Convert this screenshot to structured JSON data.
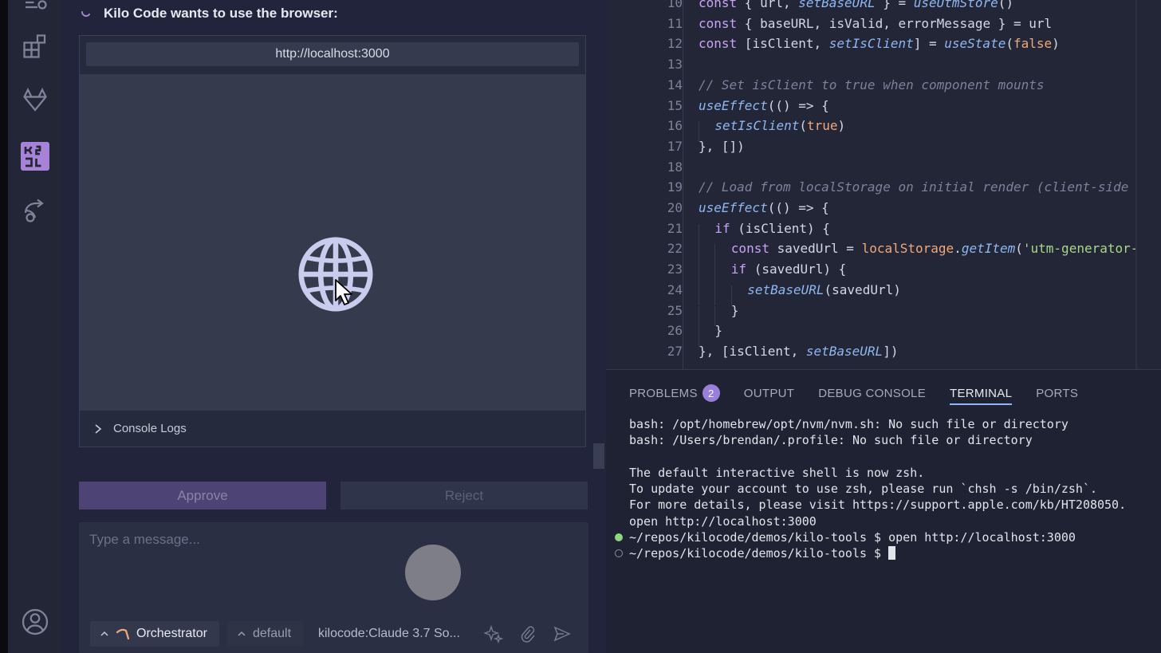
{
  "colors": {
    "accent": "#a783d8",
    "keyword": "#c9a3f5",
    "func": "#8fb7f2",
    "string": "#a9d88b",
    "comment": "#7d8199",
    "number": "#f0a97a",
    "terminal_ok": "#8fd67e"
  },
  "chat": {
    "title": "Kilo Code wants to use the browser:",
    "browser": {
      "url": "http://localhost:3000",
      "placeholder_icon": "globe-icon",
      "console_label": "Console Logs"
    },
    "approve_label": "Approve",
    "reject_label": "Reject",
    "message_placeholder": "Type a message...",
    "mode": "Orchestrator",
    "profile": "default",
    "model": "kilocode:Claude 3.7 So..."
  },
  "activity": {
    "icons": [
      "explorer-icon",
      "extensions-icon",
      "gitlab-icon",
      "kilo-code-icon",
      "remote-icon",
      "account-icon"
    ]
  },
  "editor": {
    "lines": [
      {
        "n": "10",
        "indent": 0,
        "tokens": [
          [
            "kw",
            "const"
          ],
          [
            "p",
            " { "
          ],
          [
            "v",
            "url"
          ],
          [
            "p",
            ", "
          ],
          [
            "fn",
            "setBaseURL"
          ],
          [
            "p",
            " } = "
          ],
          [
            "fn",
            "useUtmStore"
          ],
          [
            "p",
            "()"
          ]
        ]
      },
      {
        "n": "11",
        "indent": 0,
        "tokens": [
          [
            "kw",
            "const"
          ],
          [
            "p",
            " { "
          ],
          [
            "v",
            "baseURL"
          ],
          [
            "p",
            ", "
          ],
          [
            "v",
            "isValid"
          ],
          [
            "p",
            ", "
          ],
          [
            "v",
            "errorMessage"
          ],
          [
            "p",
            " } = "
          ],
          [
            "v",
            "url"
          ]
        ]
      },
      {
        "n": "12",
        "indent": 0,
        "tokens": [
          [
            "kw",
            "const"
          ],
          [
            "p",
            " ["
          ],
          [
            "v",
            "isClient"
          ],
          [
            "p",
            ", "
          ],
          [
            "fn",
            "setIsClient"
          ],
          [
            "p",
            "] = "
          ],
          [
            "fn",
            "useState"
          ],
          [
            "p",
            "("
          ],
          [
            "num",
            "false"
          ],
          [
            "p",
            ")"
          ]
        ]
      },
      {
        "n": "13",
        "indent": 0,
        "tokens": []
      },
      {
        "n": "14",
        "indent": 0,
        "tokens": [
          [
            "cm",
            "// Set isClient to true when component mounts"
          ]
        ]
      },
      {
        "n": "15",
        "indent": 0,
        "tokens": [
          [
            "fn",
            "useEffect"
          ],
          [
            "p",
            "(() => {"
          ]
        ]
      },
      {
        "n": "16",
        "indent": 1,
        "tokens": [
          [
            "fn",
            "setIsClient"
          ],
          [
            "p",
            "("
          ],
          [
            "num",
            "true"
          ],
          [
            "p",
            ")"
          ]
        ]
      },
      {
        "n": "17",
        "indent": 0,
        "tokens": [
          [
            "p",
            "}, [])"
          ]
        ]
      },
      {
        "n": "18",
        "indent": 0,
        "tokens": []
      },
      {
        "n": "19",
        "indent": 0,
        "tokens": [
          [
            "cm",
            "// Load from localStorage on initial render (client-side"
          ]
        ]
      },
      {
        "n": "20",
        "indent": 0,
        "tokens": [
          [
            "fn",
            "useEffect"
          ],
          [
            "p",
            "(() => {"
          ]
        ]
      },
      {
        "n": "21",
        "indent": 1,
        "tokens": [
          [
            "kw",
            "if"
          ],
          [
            "p",
            " ("
          ],
          [
            "v",
            "isClient"
          ],
          [
            "p",
            ") {"
          ]
        ]
      },
      {
        "n": "22",
        "indent": 2,
        "tokens": [
          [
            "kw",
            "const"
          ],
          [
            "p",
            " "
          ],
          [
            "v",
            "savedUrl"
          ],
          [
            "p",
            " = "
          ],
          [
            "num",
            "localStorage"
          ],
          [
            "p",
            "."
          ],
          [
            "fn",
            "getItem"
          ],
          [
            "p",
            "("
          ],
          [
            "str",
            "'utm-generator-"
          ]
        ]
      },
      {
        "n": "23",
        "indent": 2,
        "tokens": [
          [
            "kw",
            "if"
          ],
          [
            "p",
            " ("
          ],
          [
            "v",
            "savedUrl"
          ],
          [
            "p",
            ") {"
          ]
        ]
      },
      {
        "n": "24",
        "indent": 3,
        "tokens": [
          [
            "fn",
            "setBaseURL"
          ],
          [
            "p",
            "("
          ],
          [
            "v",
            "savedUrl"
          ],
          [
            "p",
            ")"
          ]
        ]
      },
      {
        "n": "25",
        "indent": 2,
        "tokens": [
          [
            "p",
            "}"
          ]
        ]
      },
      {
        "n": "26",
        "indent": 1,
        "tokens": [
          [
            "p",
            "}"
          ]
        ]
      },
      {
        "n": "27",
        "indent": 0,
        "tokens": [
          [
            "p",
            "}, ["
          ],
          [
            "v",
            "isClient"
          ],
          [
            "p",
            ", "
          ],
          [
            "fn",
            "setBaseURL"
          ],
          [
            "p",
            "])"
          ]
        ]
      }
    ]
  },
  "panel": {
    "tabs": [
      {
        "label": "PROBLEMS",
        "badge": "2",
        "active": false
      },
      {
        "label": "OUTPUT",
        "badge": "",
        "active": false
      },
      {
        "label": "DEBUG CONSOLE",
        "badge": "",
        "active": false
      },
      {
        "label": "TERMINAL",
        "badge": "",
        "active": true
      },
      {
        "label": "PORTS",
        "badge": "",
        "active": false
      }
    ],
    "terminal_lines": [
      {
        "text": "bash: /opt/homebrew/opt/nvm/nvm.sh: No such file or directory",
        "marker": ""
      },
      {
        "text": "bash: /Users/brendan/.profile: No such file or directory",
        "marker": ""
      },
      {
        "text": "",
        "marker": ""
      },
      {
        "text": "The default interactive shell is now zsh.",
        "marker": ""
      },
      {
        "text": "To update your account to use zsh, please run `chsh -s /bin/zsh`.",
        "marker": ""
      },
      {
        "text": "For more details, please visit https://support.apple.com/kb/HT208050.",
        "marker": ""
      },
      {
        "text": "open http://localhost:3000",
        "marker": ""
      },
      {
        "text": "~/repos/kilocode/demos/kilo-tools $ open http://localhost:3000",
        "marker": "success"
      },
      {
        "text": "~/repos/kilocode/demos/kilo-tools $ ",
        "marker": "idle"
      }
    ]
  }
}
